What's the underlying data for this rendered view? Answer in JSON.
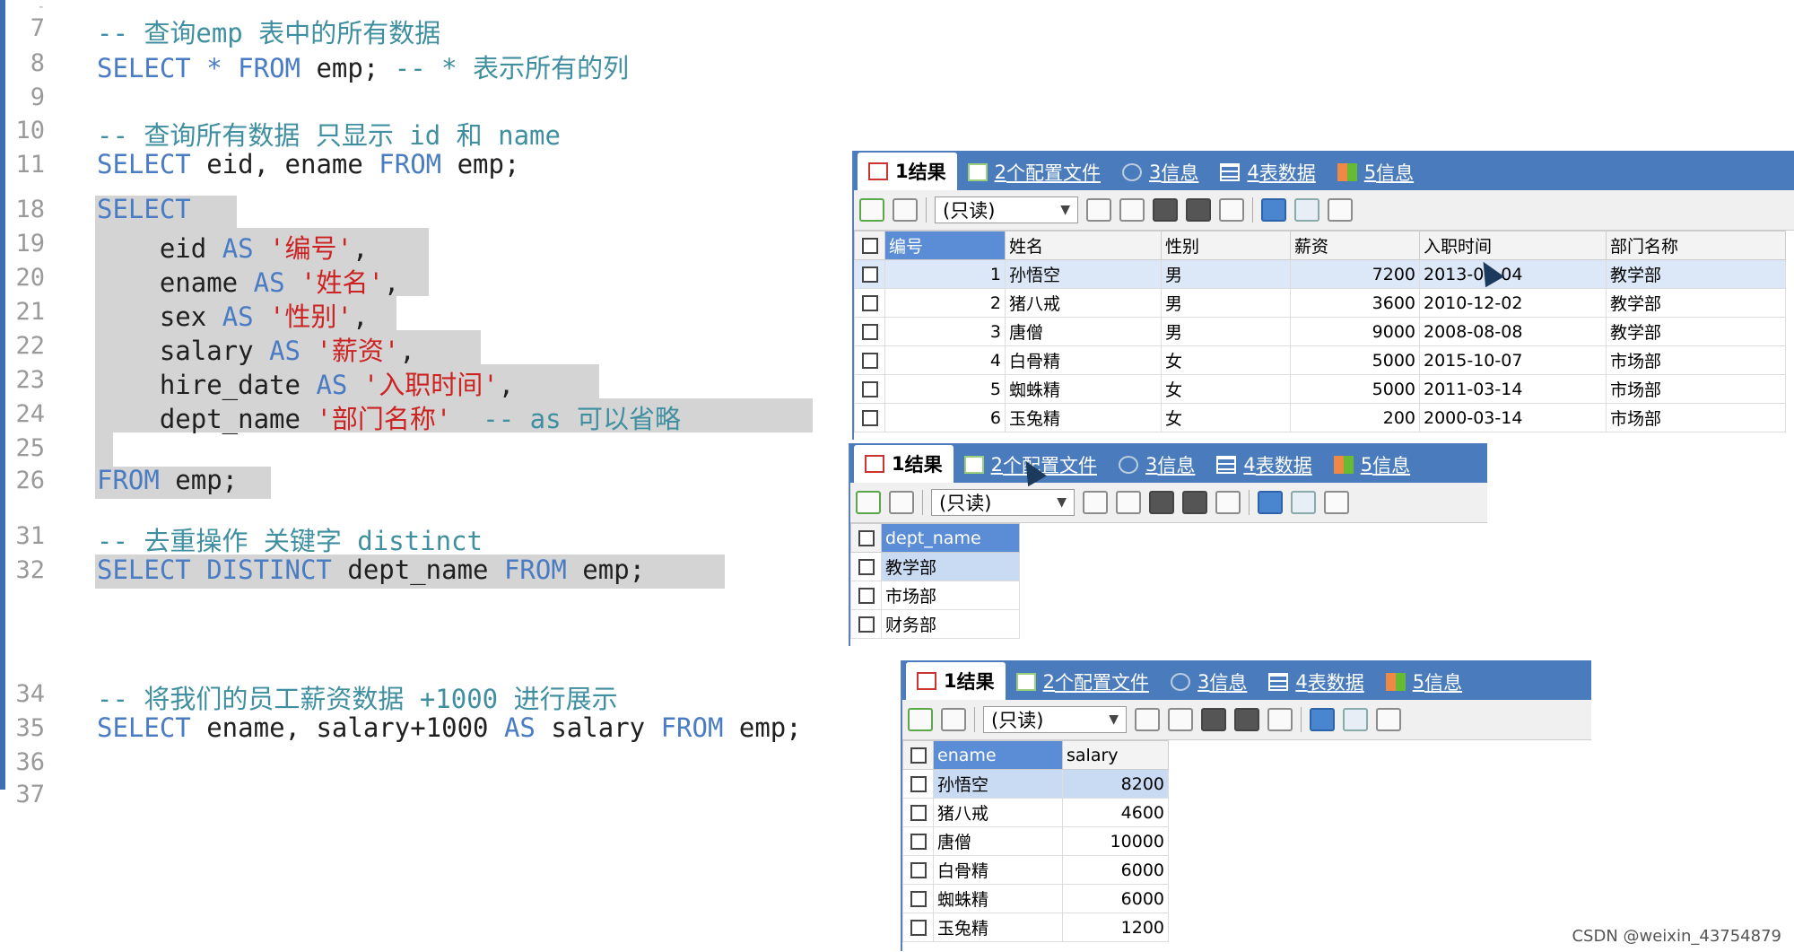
{
  "editor": {
    "lines": [
      {
        "n": "7",
        "segments": [
          [
            "cm",
            "-- 查询emp 表中的所有数据"
          ]
        ]
      },
      {
        "n": "8",
        "segments": [
          [
            "kw",
            "SELECT"
          ],
          [
            "",
            ""
          ],
          [
            "kw",
            " * "
          ],
          [
            "kw",
            "FROM"
          ],
          [
            "",
            " emp; "
          ],
          [
            "cm",
            "-- * 表示所有的列"
          ]
        ]
      },
      {
        "n": "9",
        "segments": []
      },
      {
        "n": "10",
        "segments": [
          [
            "cm",
            "-- 查询所有数据 只显示 id 和 name"
          ]
        ]
      },
      {
        "n": "11",
        "segments": [
          [
            "kw",
            "SELECT"
          ],
          [
            "",
            " eid, ename "
          ],
          [
            "kw",
            "FROM"
          ],
          [
            "",
            " emp;"
          ]
        ]
      },
      {
        "n": "18",
        "segments": [
          [
            "kw",
            "SELECT"
          ]
        ]
      },
      {
        "n": "19",
        "segments": [
          [
            "",
            "    eid "
          ],
          [
            "kw",
            "AS"
          ],
          [
            "str",
            " '编号'"
          ],
          [
            "",
            ","
          ]
        ]
      },
      {
        "n": "20",
        "segments": [
          [
            "",
            "    ename "
          ],
          [
            "kw",
            "AS"
          ],
          [
            "str",
            " '姓名'"
          ],
          [
            "",
            ","
          ]
        ]
      },
      {
        "n": "21",
        "segments": [
          [
            "",
            "    sex "
          ],
          [
            "kw",
            "AS"
          ],
          [
            "str",
            " '性别'"
          ],
          [
            "",
            ","
          ]
        ]
      },
      {
        "n": "22",
        "segments": [
          [
            "",
            "    salary "
          ],
          [
            "kw",
            "AS"
          ],
          [
            "str",
            " '薪资'"
          ],
          [
            "",
            ","
          ]
        ]
      },
      {
        "n": "23",
        "segments": [
          [
            "",
            "    hire_date "
          ],
          [
            "kw",
            "AS"
          ],
          [
            "str",
            " '入职时间'"
          ],
          [
            "",
            ","
          ]
        ]
      },
      {
        "n": "24",
        "segments": [
          [
            "",
            "    dept_name "
          ],
          [
            "str",
            "'部门名称'"
          ],
          [
            "cm",
            "  -- as 可以省略"
          ]
        ]
      },
      {
        "n": "25",
        "segments": []
      },
      {
        "n": "26",
        "segments": [
          [
            "kw",
            "FROM"
          ],
          [
            "",
            " emp;"
          ]
        ]
      },
      {
        "n": "31",
        "segments": [
          [
            "cm",
            "-- 去重操作 关键字 distinct"
          ]
        ]
      },
      {
        "n": "32",
        "segments": [
          [
            "kw",
            "SELECT DISTINCT"
          ],
          [
            "",
            " dept_name "
          ],
          [
            "kw",
            "FROM"
          ],
          [
            "",
            " emp;"
          ]
        ]
      },
      {
        "n": "34",
        "segments": [
          [
            "cm",
            "-- 将我们的员工薪资数据 +1000 进行展示"
          ]
        ]
      },
      {
        "n": "35",
        "segments": [
          [
            "kw",
            "SELECT"
          ],
          [
            "",
            " ename, salary+1000 "
          ],
          [
            "kw",
            "AS"
          ],
          [
            "",
            " salary "
          ],
          [
            "kw",
            "FROM"
          ],
          [
            "",
            " emp;"
          ]
        ]
      },
      {
        "n": "36",
        "segments": []
      },
      {
        "n": "37",
        "segments": []
      }
    ]
  },
  "tabs": [
    {
      "num": "1",
      "label": "结果"
    },
    {
      "num": "2",
      "label": "个配置文件"
    },
    {
      "num": "3",
      "label": "信息"
    },
    {
      "num": "4",
      "label": "表数据"
    },
    {
      "num": "5",
      "label": "信息"
    }
  ],
  "toolbar": {
    "mode_label": "(只读)"
  },
  "result1": {
    "columns": [
      "编号",
      "姓名",
      "性别",
      "薪资",
      "入职时间",
      "部门名称"
    ],
    "rows": [
      [
        "1",
        "孙悟空",
        "男",
        "7200",
        "2013-02-04",
        "教学部"
      ],
      [
        "2",
        "猪八戒",
        "男",
        "3600",
        "2010-12-02",
        "教学部"
      ],
      [
        "3",
        "唐僧",
        "男",
        "9000",
        "2008-08-08",
        "教学部"
      ],
      [
        "4",
        "白骨精",
        "女",
        "5000",
        "2015-10-07",
        "市场部"
      ],
      [
        "5",
        "蜘蛛精",
        "女",
        "5000",
        "2011-03-14",
        "市场部"
      ],
      [
        "6",
        "玉兔精",
        "女",
        "200",
        "2000-03-14",
        "市场部"
      ]
    ]
  },
  "result2": {
    "columns": [
      "dept_name"
    ],
    "rows": [
      [
        "教学部"
      ],
      [
        "市场部"
      ],
      [
        "财务部"
      ]
    ]
  },
  "result3": {
    "columns": [
      "ename",
      "salary"
    ],
    "rows": [
      [
        "孙悟空",
        "8200"
      ],
      [
        "猪八戒",
        "4600"
      ],
      [
        "唐僧",
        "10000"
      ],
      [
        "白骨精",
        "6000"
      ],
      [
        "蜘蛛精",
        "6000"
      ],
      [
        "玉兔精",
        "1200"
      ]
    ]
  },
  "watermark": "CSDN @weixin_43754879"
}
